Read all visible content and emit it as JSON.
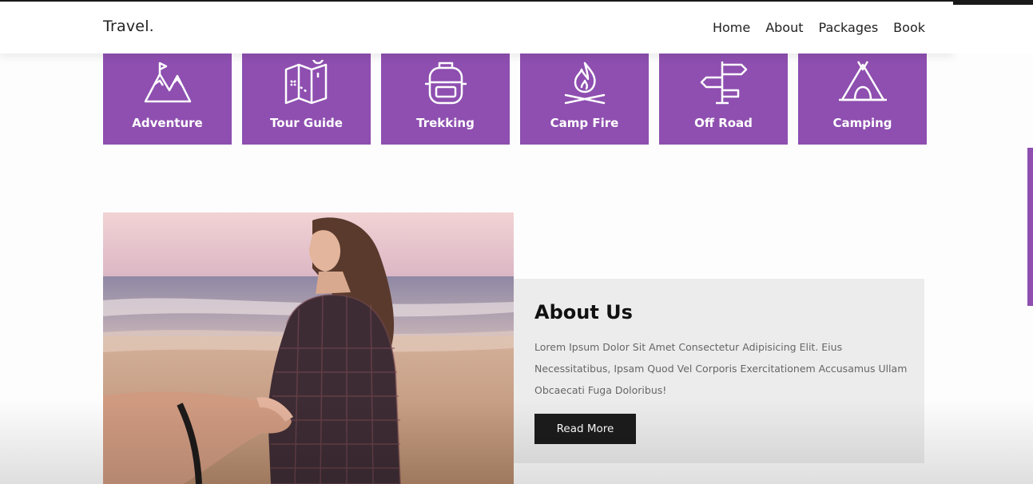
{
  "header": {
    "logo": "Travel.",
    "nav": [
      "Home",
      "About",
      "Packages",
      "Book"
    ]
  },
  "categories": [
    {
      "label": "Adventure",
      "icon": "mountain-icon"
    },
    {
      "label": "Tour Guide",
      "icon": "map-icon"
    },
    {
      "label": "Trekking",
      "icon": "backpack-icon"
    },
    {
      "label": "Camp Fire",
      "icon": "campfire-icon"
    },
    {
      "label": "Off Road",
      "icon": "signpost-icon"
    },
    {
      "label": "Camping",
      "icon": "tent-icon"
    }
  ],
  "about": {
    "title": "About Us",
    "text": "Lorem Ipsum Dolor Sit Amet Consectetur Adipisicing Elit. Eius Necessitatibus, Ipsam Quod Vel Corporis Exercitationem Accusamus Ullam Obcaecati Fuga Doloribus!",
    "button": "Read More"
  },
  "colors": {
    "accent": "#8e4fb0",
    "button": "#1c1c1c",
    "about_bg": "#ececec"
  }
}
